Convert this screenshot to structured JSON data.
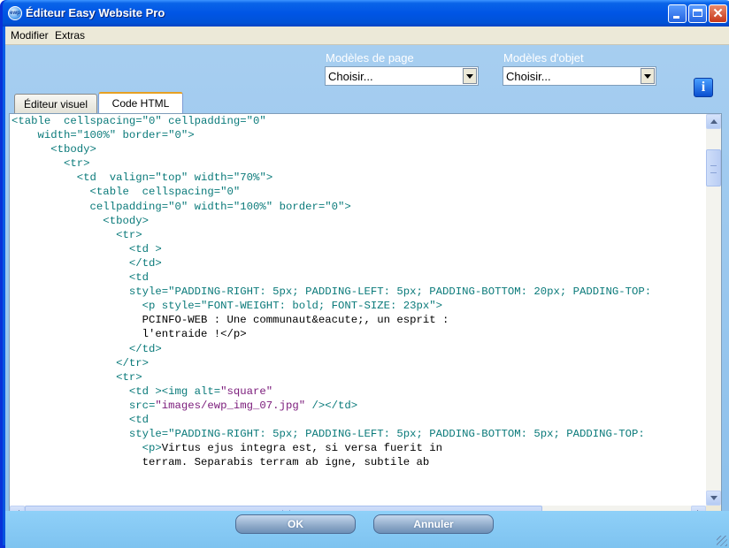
{
  "window": {
    "title": "Éditeur Easy Website Pro",
    "icon": "ewp-app-icon",
    "icon_text": "ewp"
  },
  "menubar": {
    "items": [
      "Modifier",
      "Extras"
    ]
  },
  "tabs": [
    {
      "label": "Éditeur visuel",
      "active": false
    },
    {
      "label": "Code HTML",
      "active": true
    }
  ],
  "page_templates": {
    "label": "Modèles de page",
    "selected": "Choisir..."
  },
  "object_templates": {
    "label": "Modèles d'objet",
    "selected": "Choisir..."
  },
  "info_button": {
    "icon": "info-icon",
    "glyph": "i"
  },
  "code_lines": [
    "<table  cellspacing=\"0\" cellpadding=\"0\"",
    "    width=\"100%\" border=\"0\">",
    "      <tbody>",
    "        <tr>",
    "          <td  valign=\"top\" width=\"70%\">",
    "            <table  cellspacing=\"0\"",
    "            cellpadding=\"0\" width=\"100%\" border=\"0\">",
    "              <tbody>",
    "                <tr>",
    "                  <td >",
    "                  </td>",
    "",
    "                  <td",
    "                  style=\"PADDING-RIGHT: 5px; PADDING-LEFT: 5px; PADDING-BOTTOM: 20px; PADDING-TOP:",
    "                    <p style=\"FONT-WEIGHT: bold; FONT-SIZE: 23px\">",
    "                    PCINFO-WEB : Une communaut&eacute;, un esprit :",
    "                    l'entraide !</p>",
    "                  </td>",
    "                </tr>",
    "",
    "                <tr>",
    "                  <td ><img alt=\"square\"",
    "                  src=\"images/ewp_img_07.jpg\" /></td>",
    "",
    "                  <td",
    "                  style=\"PADDING-RIGHT: 5px; PADDING-LEFT: 5px; PADDING-BOTTOM: 5px; PADDING-TOP:",
    "                    <p>Virtus ejus integra est, si versa fuerit in",
    "                    terram. Separabis terram ab igne, subtile ab"
  ],
  "buttons": {
    "ok_label": "OK",
    "cancel_label": "Annuler"
  },
  "colors": {
    "titlebar": "#0055e5",
    "panel_bg": "#9dc9ed",
    "code_tag": "#0a7a7a",
    "code_string": "#7a1a7a",
    "code_text": "#000000"
  }
}
